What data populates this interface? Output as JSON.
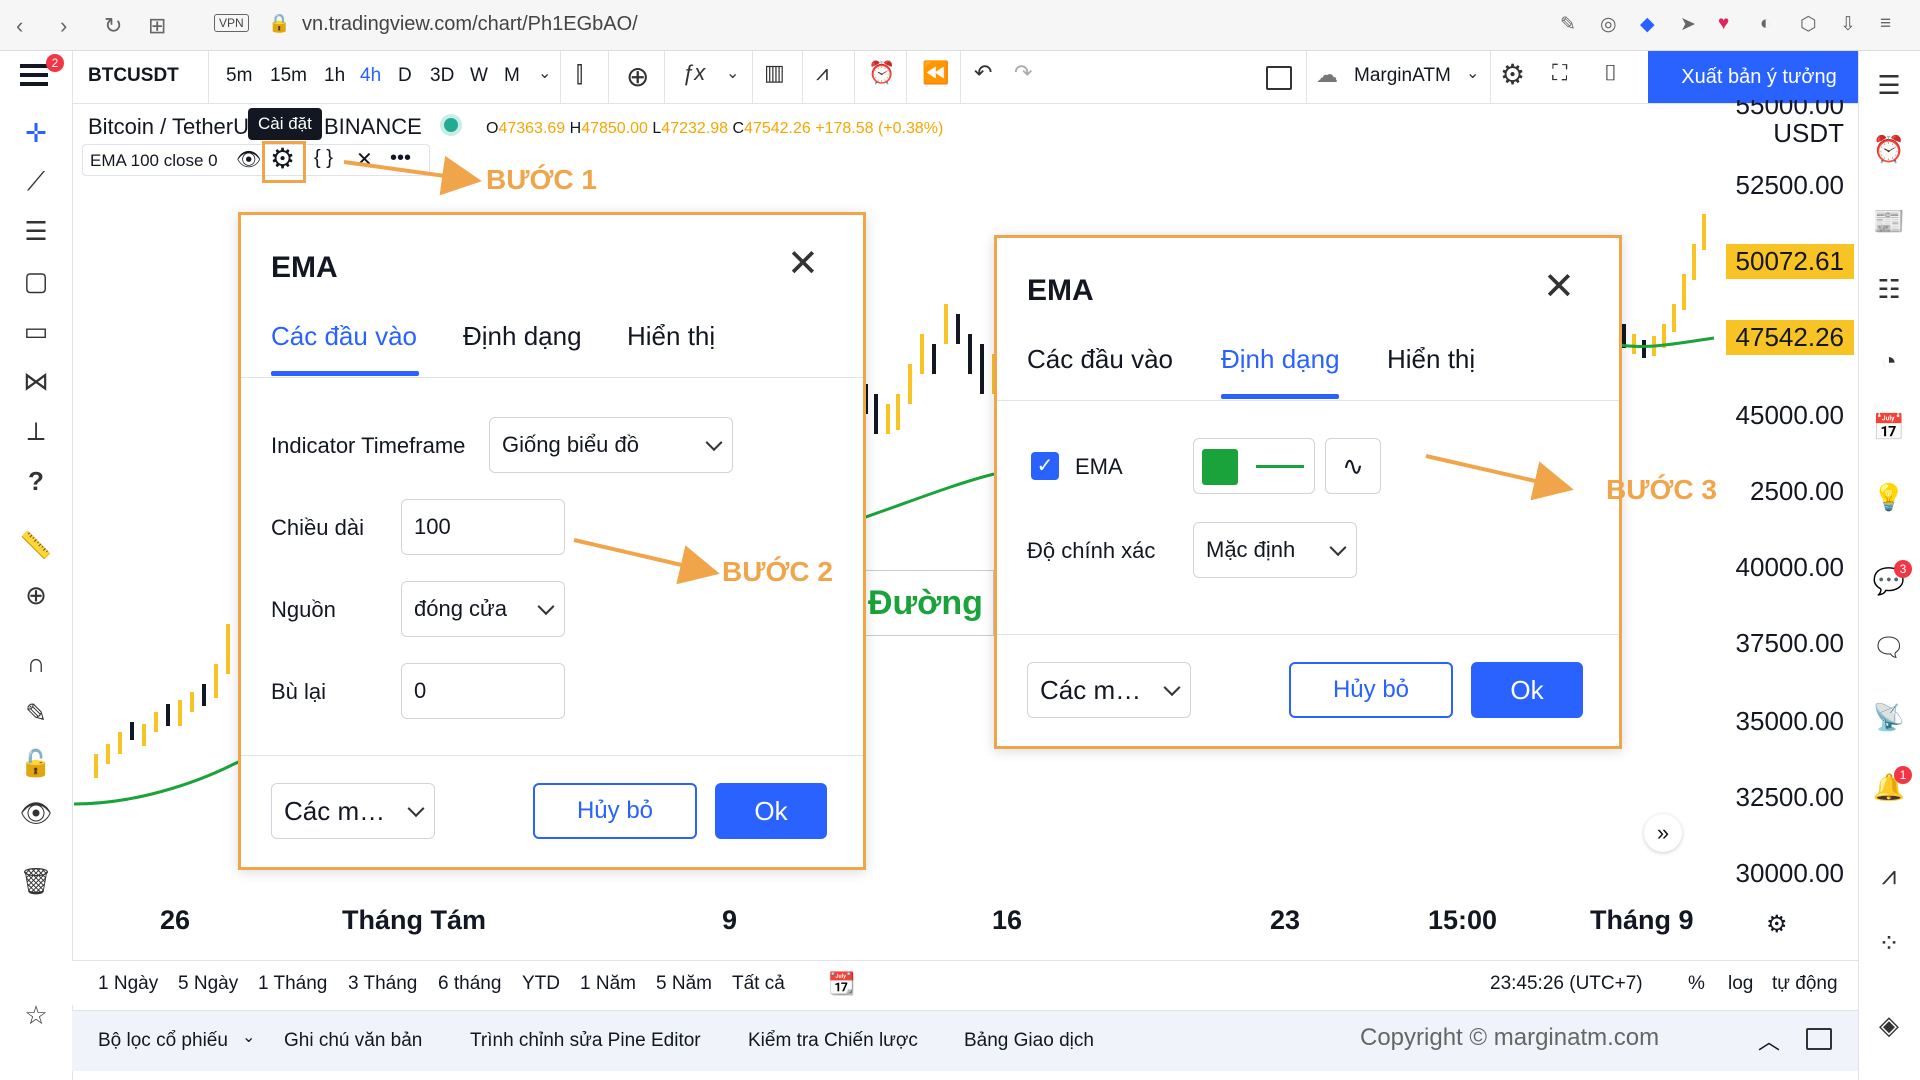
{
  "browser": {
    "url": "vn.tradingview.com/chart/Ph1EGbAO/",
    "vpn": "VPN"
  },
  "toolbar": {
    "symbol": "BTCUSDT",
    "intervals": [
      "5m",
      "15m",
      "1h",
      "4h",
      "D",
      "3D",
      "W",
      "M"
    ],
    "active_interval": "4h",
    "layout_name": "MarginATM",
    "publish": "Xuất bản ý tưởng",
    "menu_badge": "2"
  },
  "legend": {
    "pair": "Bitcoin / TetherU",
    "exchange": "BINANCE",
    "o_label": "O",
    "o": "47363.69",
    "h_label": "H",
    "h": "47850.00",
    "l_label": "L",
    "l": "47232.98",
    "c_label": "C",
    "c": "47542.26",
    "change": "+178.58 (+0.38%)",
    "indicator": "EMA 100 close 0",
    "tooltip": "Cài đặt"
  },
  "price_axis": {
    "top_partial": "55000.00",
    "unit": "USDT",
    "labels": [
      "52500.00",
      "45000.00",
      "2500.00",
      "40000.00",
      "37500.00",
      "35000.00",
      "32500.00",
      "30000.00"
    ],
    "tag_high": "50072.61",
    "tag_last": "47542.26",
    "tag_color": "#f7c325"
  },
  "time_axis": [
    "26",
    "Tháng Tám",
    "9",
    "16",
    "23",
    "15:00",
    "Tháng 9"
  ],
  "range_bar": {
    "ranges": [
      "1 Ngày",
      "5 Ngày",
      "1 Tháng",
      "3 Tháng",
      "6 tháng",
      "YTD",
      "1 Năm",
      "5 Năm",
      "Tất cả"
    ],
    "clock": "23:45:26 (UTC+7)",
    "percent": "%",
    "log": "log",
    "auto": "tự động"
  },
  "footer": {
    "tabs": [
      "Bộ lọc cổ phiếu",
      "Ghi chú văn bản",
      "Trình chỉnh sửa Pine Editor",
      "Kiểm tra Chiến lược",
      "Bảng Giao dịch"
    ],
    "copyright": "Copyright © marginatm.com"
  },
  "chart_overlay_text": "Đường",
  "dialog1": {
    "title": "EMA",
    "tabs": [
      "Các đầu vào",
      "Định dạng",
      "Hiển thị"
    ],
    "timeframe_label": "Indicator Timeframe",
    "timeframe_value": "Giống biểu đồ",
    "length_label": "Chiều dài",
    "length_value": "100",
    "source_label": "Nguồn",
    "source_value": "đóng cửa",
    "offset_label": "Bù lại",
    "offset_value": "0",
    "defaults": "Các m…",
    "cancel": "Hủy bỏ",
    "ok": "Ok"
  },
  "dialog2": {
    "title": "EMA",
    "tabs": [
      "Các đầu vào",
      "Định dạng",
      "Hiển thị"
    ],
    "ema_label": "EMA",
    "ema_checked": true,
    "ema_color": "#1aa33a",
    "precision_label": "Độ chính xác",
    "precision_value": "Mặc định",
    "defaults": "Các m…",
    "cancel": "Hủy bỏ",
    "ok": "Ok"
  },
  "steps": {
    "step1": "BƯỚC 1",
    "step2": "BƯỚC 2",
    "step3": "BƯỚC 3"
  },
  "right_badges": {
    "chat": "3",
    "alerts": "1"
  },
  "colors": {
    "accent": "#2962ff",
    "annotation": "#f0a54a",
    "ema_line": "#1aa33a",
    "candle_up": "#f7c325",
    "candle_down": "#131722"
  }
}
